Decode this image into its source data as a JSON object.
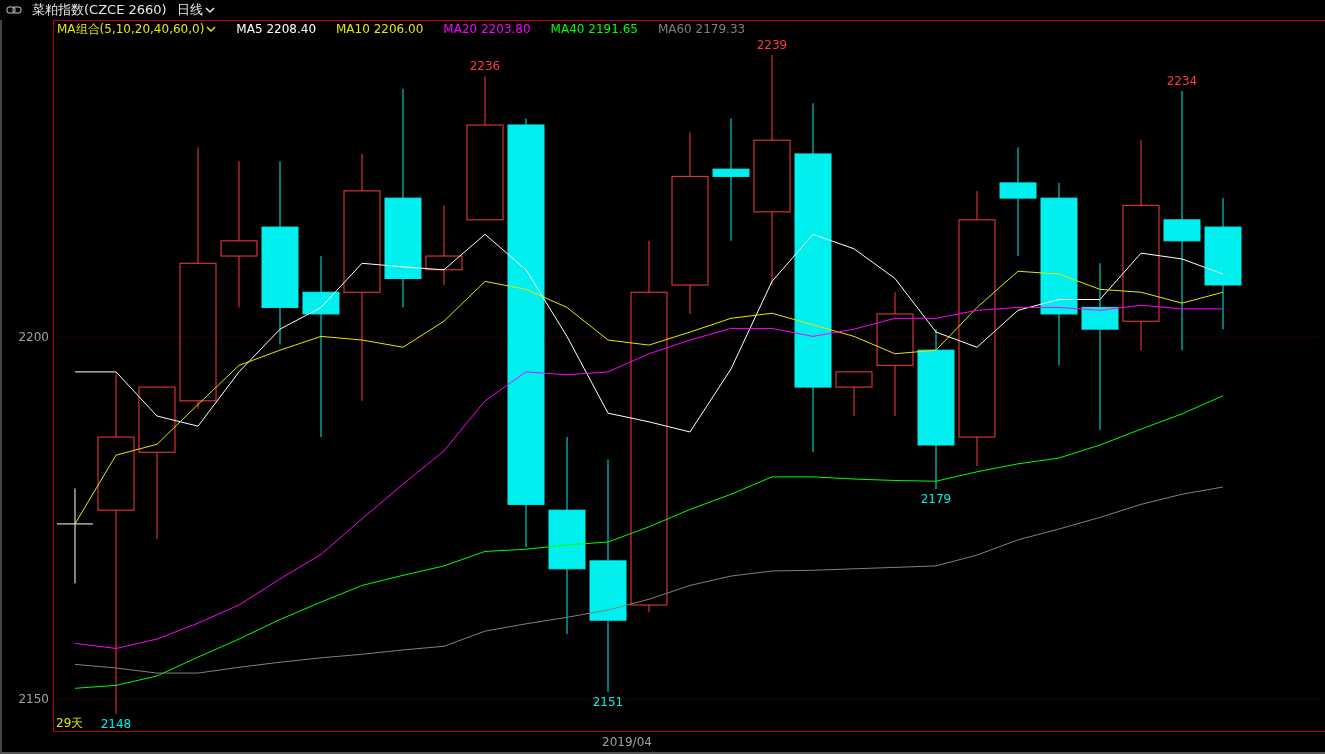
{
  "title_bar": {
    "instrument": "菜粕指数(CZCE 2660)",
    "period": "日线"
  },
  "legend": {
    "group": "MA组合(5,10,20,40,60,0)",
    "values": [
      "2208.40",
      "2206.00",
      "2203.80",
      "2191.65",
      "2179.33"
    ]
  },
  "period_count": "29天",
  "date_label": "2019/04",
  "chart_data": {
    "type": "line",
    "ylim": [
      2145.6,
      2243.8
    ],
    "yticks": [
      2150,
      2200
    ],
    "series": [
      {
        "name": "MA5",
        "color": "#ffffff",
        "values": [
          2195.2,
          2195.2,
          2189.1,
          2187.7,
          2195.2,
          2201.1,
          2204.1,
          2210.2,
          2209.7,
          2209.3,
          2214.2,
          2209.3,
          2200.1,
          2189.5,
          2188.3,
          2186.9,
          2195.6,
          2207.7,
          2214.2,
          2212.2,
          2208.1,
          2200.7,
          2198.6,
          2203.7,
          2205.2,
          2205.2,
          2211.6,
          2210.8,
          2208.7
        ]
      },
      {
        "name": "MA10",
        "color": "#e6e600",
        "values": [
          2174.2,
          2183.7,
          2185.2,
          2190.7,
          2196.1,
          2198.2,
          2200.1,
          2199.6,
          2198.6,
          2202.2,
          2207.7,
          2206.6,
          2204.1,
          2199.6,
          2198.9,
          2200.7,
          2202.6,
          2203.3,
          2201.7,
          2200.1,
          2197.7,
          2198.2,
          2204.1,
          2209.1,
          2208.7,
          2206.6,
          2206.2,
          2204.7,
          2206.2
        ]
      },
      {
        "name": "MA20",
        "color": "#ff00ff",
        "values": [
          2157.7,
          2157.0,
          2158.3,
          2160.5,
          2163.0,
          2166.6,
          2170.0,
          2174.9,
          2179.7,
          2184.3,
          2191.2,
          2195.2,
          2194.8,
          2195.2,
          2197.7,
          2199.6,
          2201.2,
          2201.2,
          2200.1,
          2201.1,
          2202.6,
          2202.6,
          2203.7,
          2204.1,
          2204.1,
          2203.7,
          2204.4,
          2203.9,
          2203.9
        ]
      },
      {
        "name": "MA40",
        "color": "#00ff00",
        "values": [
          2151.5,
          2151.9,
          2153.2,
          2155.8,
          2158.3,
          2161.0,
          2163.4,
          2165.7,
          2167.1,
          2168.4,
          2170.4,
          2170.7,
          2171.3,
          2171.7,
          2173.8,
          2176.2,
          2178.3,
          2180.7,
          2180.7,
          2180.4,
          2180.2,
          2180.1,
          2181.4,
          2182.5,
          2183.3,
          2185.1,
          2187.3,
          2189.4,
          2191.9
        ]
      },
      {
        "name": "MA60",
        "color": "#808080",
        "values": [
          2154.8,
          2154.3,
          2153.6,
          2153.6,
          2154.4,
          2155.1,
          2155.7,
          2156.2,
          2156.8,
          2157.3,
          2159.4,
          2160.4,
          2161.3,
          2162.3,
          2163.8,
          2165.7,
          2167.0,
          2167.7,
          2167.8,
          2168.0,
          2168.2,
          2168.4,
          2169.9,
          2172.0,
          2173.5,
          2175.1,
          2176.9,
          2178.3,
          2179.3
        ]
      }
    ],
    "annotations": [
      "2236",
      "2239",
      "2234",
      "2148",
      "2151",
      "2179"
    ]
  }
}
